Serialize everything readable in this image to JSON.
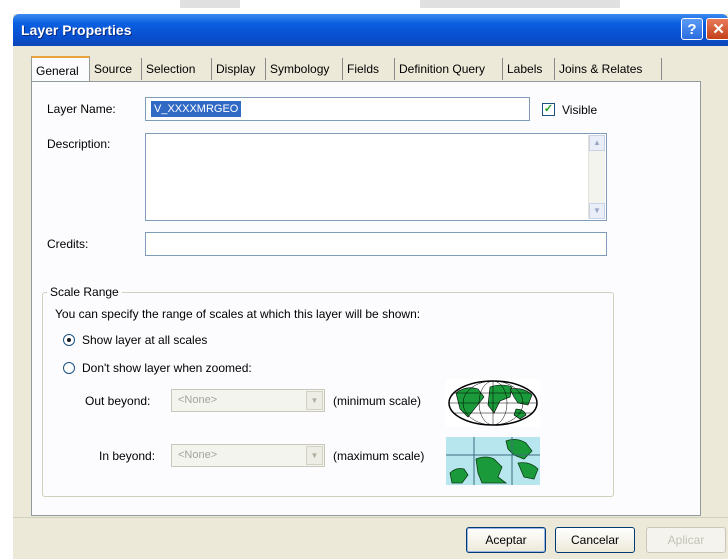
{
  "window": {
    "title": "Layer Properties",
    "help_glyph": "?",
    "close_glyph": "✕"
  },
  "tabs": [
    {
      "label": "General",
      "active": true
    },
    {
      "label": "Source"
    },
    {
      "label": "Selection"
    },
    {
      "label": "Display"
    },
    {
      "label": "Symbology"
    },
    {
      "label": "Fields"
    },
    {
      "label": "Definition Query"
    },
    {
      "label": "Labels"
    },
    {
      "label": "Joins & Relates"
    }
  ],
  "general": {
    "layer_name_label": "Layer Name:",
    "layer_name_value": "V_XXXXMRGEO",
    "visible_label": "Visible",
    "visible_checked": true,
    "description_label": "Description:",
    "description_value": "",
    "credits_label": "Credits:",
    "credits_value": ""
  },
  "scale_range": {
    "title": "Scale Range",
    "intro": "You can specify the range of scales at which this layer will be shown:",
    "option_all": "Show layer at all scales",
    "option_zoomed": "Don't show layer when zoomed:",
    "selected": "all",
    "out_beyond_label": "Out beyond:",
    "out_beyond_value": "<None>",
    "out_beyond_hint": "(minimum scale)",
    "in_beyond_label": "In beyond:",
    "in_beyond_value": "<None>",
    "in_beyond_hint": "(maximum scale)"
  },
  "buttons": {
    "ok": "Aceptar",
    "cancel": "Cancelar",
    "apply": "Aplicar"
  },
  "colors": {
    "title_bar": "#0a5fe0",
    "selection": "#316ac5",
    "active_tab_accent": "#e8a33d",
    "globe_land": "#1a9a3a",
    "map_water": "#b8e6ee"
  },
  "icons": {
    "globe": "world-globe-icon",
    "zoomed_map": "zoomed-map-icon",
    "dropdown": "chevron-down-icon"
  }
}
